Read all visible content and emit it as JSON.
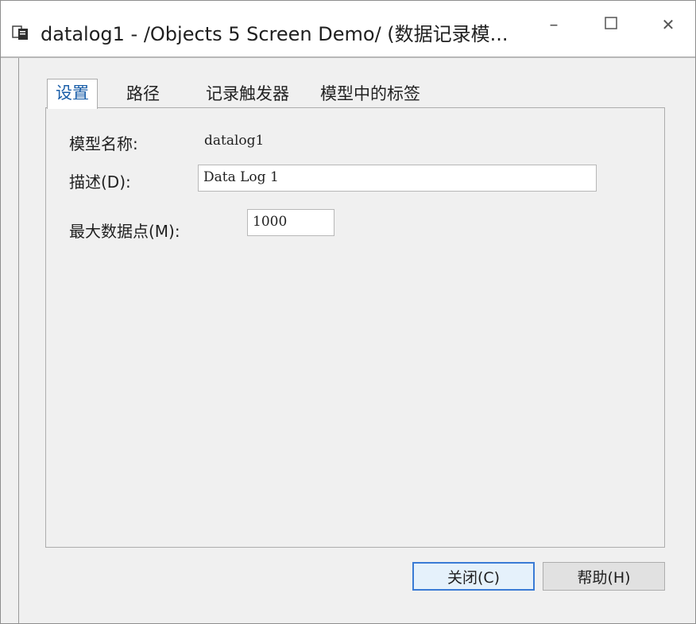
{
  "window": {
    "title": "datalog1 - /Objects 5 Screen Demo/ (数据记录模...",
    "minimize_glyph": "–",
    "close_glyph": "✕"
  },
  "tabs": [
    {
      "label": "设置",
      "active": true
    },
    {
      "label": "路径",
      "active": false
    },
    {
      "label": "记录触发器",
      "active": false
    },
    {
      "label": "模型中的标签",
      "active": false
    }
  ],
  "form": {
    "model_name_label": "模型名称:",
    "model_name_value": "datalog1",
    "description_label": "描述(D):",
    "description_value": "Data Log 1",
    "max_points_label": "最大数据点(M):",
    "max_points_value": "1000"
  },
  "buttons": {
    "close_label": "关闭(C)",
    "help_label": "帮助(H)"
  },
  "colors": {
    "active_tab_text": "#1a5ea8",
    "default_button_border": "#3a7bd5"
  }
}
